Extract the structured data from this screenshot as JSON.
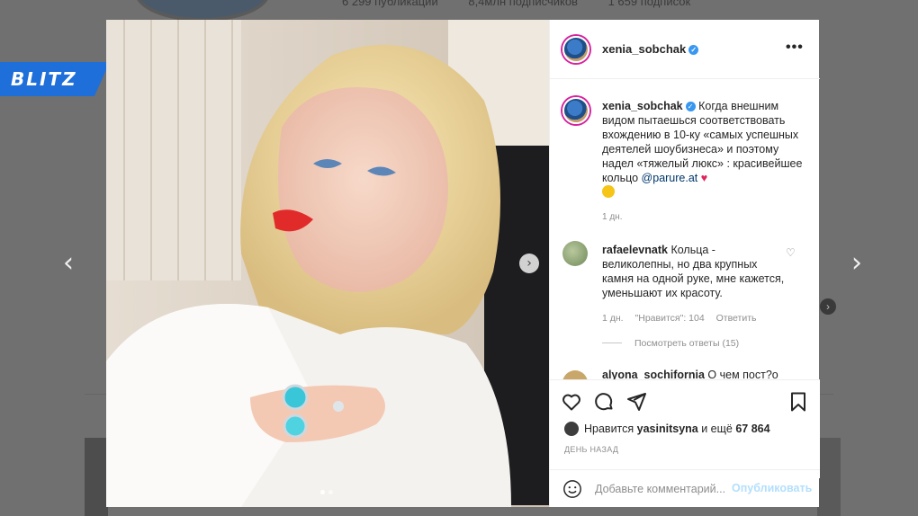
{
  "background": {
    "stats": [
      "6 299 публикации",
      "8,4млн подписчиков",
      "1 659 подписок"
    ]
  },
  "watermark": {
    "logo_text": "BLITZ",
    "brand_color": "#1e6fd9"
  },
  "post": {
    "username": "xenia_sobchak",
    "caption_username": "xenia_sobchak",
    "caption_text": " Когда внешним видом пытаешься соответствовать вхождению в 10-ку «самых успешных деятелей шоубизнеса» и поэтому надел «тяжелый люкс» : красивейшее кольцо ",
    "caption_mention": "@parure.at",
    "caption_time": "1 дн.",
    "comment": {
      "username": "rafaelevnatk",
      "text": " Кольца - великолепны, но два крупных камня на одной руке, мне кажется, уменьшают их красоту.",
      "time": "1 дн.",
      "likes": "\"Нравится\": 104",
      "reply": "Ответить",
      "view_replies": "Посмотреть ответы (15)"
    },
    "next_comment": {
      "username": "alyona_sochifornia",
      "text": " О чем пост?о"
    },
    "likes": {
      "prefix": "Нравится ",
      "user": "yasinitsyna",
      "middle": " и ещё ",
      "count": "67 864"
    },
    "date": "ДЕНЬ НАЗАД",
    "add_comment_placeholder": "Добавьте комментарий...",
    "post_label": "Опубликовать"
  },
  "icons": {
    "verified": "verified-badge-icon",
    "more": "more-options-icon",
    "like": "heart-icon",
    "comment": "comment-bubble-icon",
    "share": "paper-plane-icon",
    "save": "bookmark-icon",
    "emoji": "smiley-icon",
    "prev": "chevron-left-icon",
    "next": "chevron-right-icon"
  },
  "colors": {
    "verified": "#3897f0",
    "link": "#00376b",
    "muted": "#8e8e8e",
    "post_button": "#b2dffc"
  }
}
